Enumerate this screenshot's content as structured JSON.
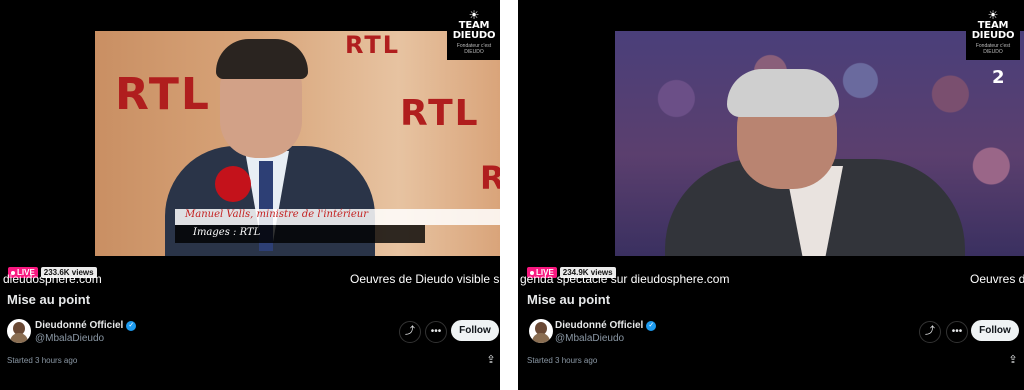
{
  "streams": [
    {
      "video": {
        "watermark": {
          "title_line1": "TEAM",
          "title_line2": "DIEUDO",
          "subtitle": "Fondateur c'est DIEUDO"
        },
        "scene": {
          "brand_text": "RTL",
          "lower_third_name": "Manuel Valls, ministre de l'intérieur",
          "lower_third_credit": "Images : RTL"
        }
      },
      "live_label": "LIVE",
      "views": "233.6K views",
      "ticker_segments": [
        "dieudosphere.com",
        "Oeuvres de Dieudo visible sur"
      ],
      "title": "Mise au point",
      "author": {
        "name": "Dieudonné Officiel",
        "handle": "@MbalaDieudo",
        "verified_icon": "verified-badge-icon"
      },
      "follow_label": "Follow",
      "started": "Started 3 hours ago"
    },
    {
      "video": {
        "watermark": {
          "title_line1": "TEAM",
          "title_line2": "DIEUDO",
          "subtitle": "Fondateur c'est DIEUDO"
        },
        "scene": {
          "channel_logo": "2"
        }
      },
      "live_label": "LIVE",
      "views": "234.9K views",
      "ticker_segments": [
        "genda spectacle sur dieudosphere.com",
        "Oeuvres de"
      ],
      "title": "Mise au point",
      "author": {
        "name": "Dieudonné Officiel",
        "handle": "@MbalaDieudo",
        "verified_icon": "verified-badge-icon"
      },
      "follow_label": "Follow",
      "started": "Started 3 hours ago"
    }
  ],
  "colors": {
    "live": "#f91880",
    "verified": "#1d9bf0",
    "background": "#000000",
    "follow_bg": "#eff3f4"
  },
  "icons": {
    "share": "share-icon",
    "more": "more-options-icon",
    "upload": "upload-icon",
    "watermark": "sun-icon"
  }
}
